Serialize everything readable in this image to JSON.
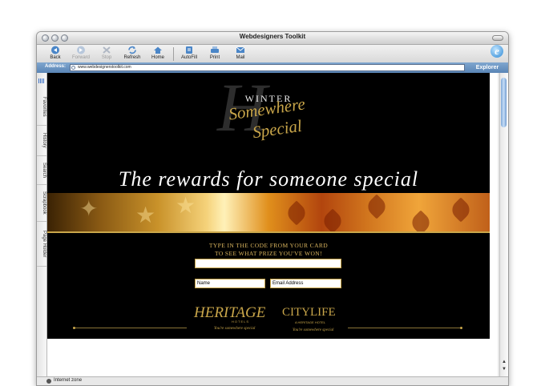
{
  "window": {
    "title": "Webdesigners Toolkit"
  },
  "toolbar": {
    "buttons": [
      {
        "label": "Back",
        "icon": "back-arrow-icon",
        "enabled": true
      },
      {
        "label": "Forward",
        "icon": "forward-arrow-icon",
        "enabled": false
      },
      {
        "label": "Stop",
        "icon": "stop-icon",
        "enabled": false
      },
      {
        "label": "Refresh",
        "icon": "refresh-icon",
        "enabled": true
      },
      {
        "label": "Home",
        "icon": "home-icon",
        "enabled": true
      },
      {
        "label": "AutoFill",
        "icon": "autofill-icon",
        "enabled": true
      },
      {
        "label": "Print",
        "icon": "print-icon",
        "enabled": true
      },
      {
        "label": "Mail",
        "icon": "mail-icon",
        "enabled": true
      }
    ]
  },
  "address": {
    "label": "Address:",
    "url": "www.webdesignerstoolkit.com",
    "explorer_label": "Explorer"
  },
  "sidebar": {
    "tabs": [
      "Favorites",
      "History",
      "Search",
      "Scrapbook",
      "Page Holder"
    ]
  },
  "page": {
    "winter": "WINTER",
    "somewhere": "Somewhere",
    "special": "Special",
    "monogram": "H",
    "tagline": "The rewards for someone special",
    "prompt_line1": "TYPE IN THE CODE FROM YOUR CARD",
    "prompt_line2": "TO SEE WHAT PRIZE YOU'VE WON!",
    "code_field_value": "",
    "name_field": "Name",
    "email_field": "Email Address",
    "heritage_logo": "HERITAGE",
    "heritage_sub": "HOTELS",
    "heritage_tag": "You're somewhere special",
    "citylife_logo": "CITYLIFE",
    "citylife_sub": "A HERITAGE HOTEL",
    "citylife_tag": "You're somewhere special"
  },
  "status": {
    "text": "Internet zone"
  },
  "colors": {
    "gold": "#c9a64a",
    "address_bar": "#6a93c2",
    "page_bg": "#000000"
  }
}
